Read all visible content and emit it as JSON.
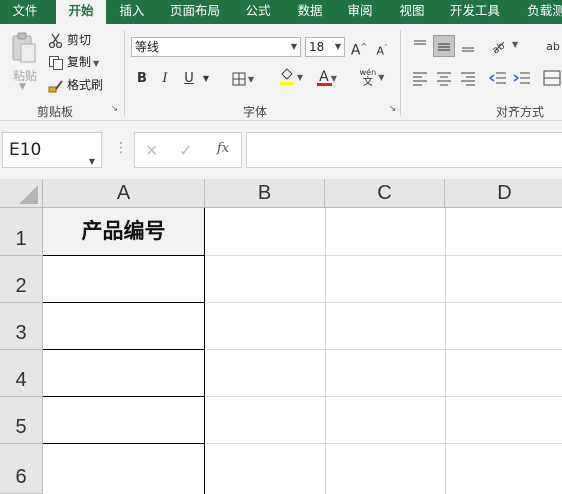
{
  "tabs": [
    "文件",
    "开始",
    "插入",
    "页面布局",
    "公式",
    "数据",
    "审阅",
    "视图",
    "开发工具",
    "负载测"
  ],
  "active_tab": "开始",
  "clipboard": {
    "paste_label": "粘贴",
    "cut_label": "剪切",
    "copy_label": "复制",
    "format_painter_label": "格式刷",
    "group_label": "剪贴板"
  },
  "font": {
    "name": "等线",
    "size": "18",
    "grow_label": "A",
    "shrink_label": "A",
    "bold_label": "B",
    "italic_label": "I",
    "underline_label": "U",
    "phonetic_top": "wén",
    "phonetic_bottom": "文",
    "font_color_label": "A",
    "group_label": "字体"
  },
  "alignment": {
    "group_label": "对齐方式",
    "wrap_label": "ab"
  },
  "formula_bar": {
    "name_box": "E10",
    "cancel_symbol": "✕",
    "enter_symbol": "✓",
    "fx_symbol": "fx",
    "formula_value": ""
  },
  "sheet": {
    "columns": [
      "A",
      "B",
      "C",
      "D"
    ],
    "rows": [
      "1",
      "2",
      "3",
      "4",
      "5",
      "6"
    ],
    "cells": {
      "A1": "产品编号"
    }
  },
  "colors": {
    "accent": "#217346",
    "font_color_bar": "#e02020",
    "highlight_bar": "#ffff00"
  }
}
